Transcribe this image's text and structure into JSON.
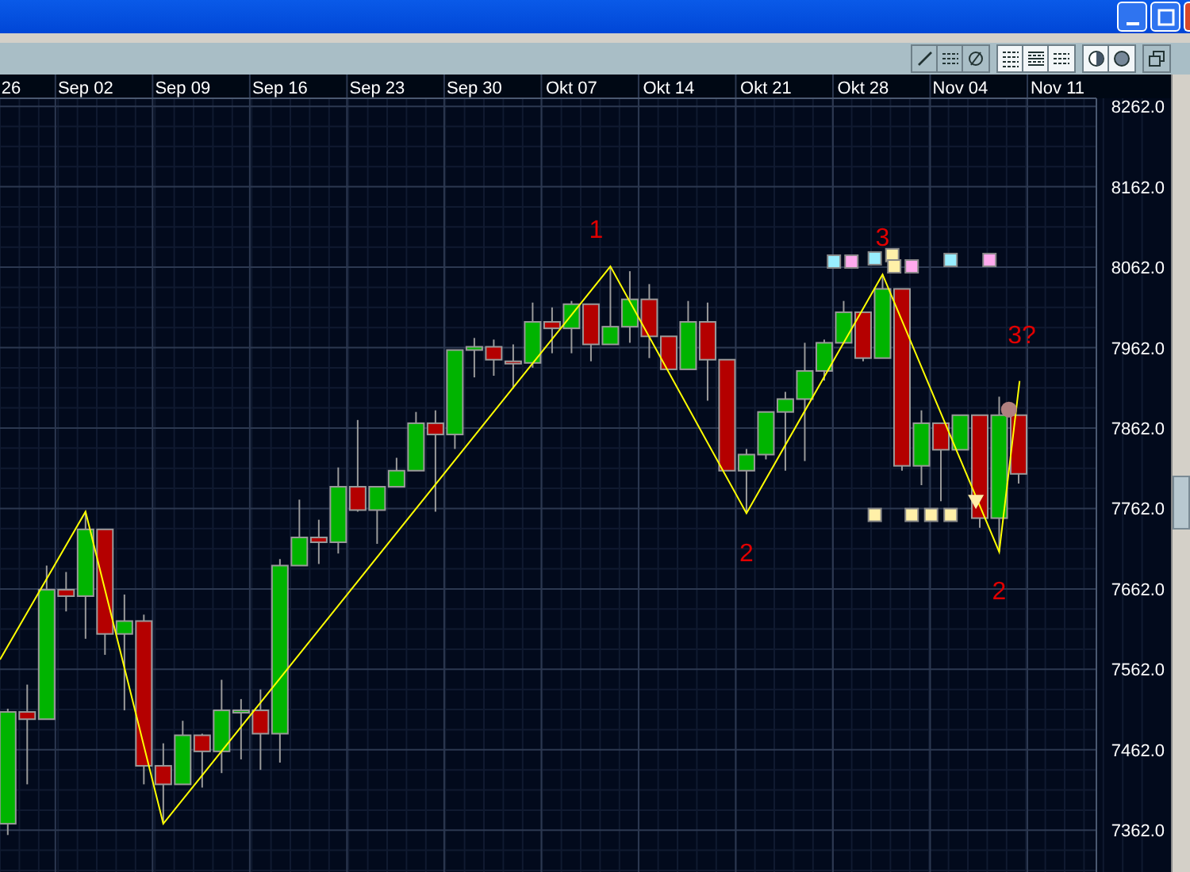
{
  "chart": {
    "chart_data": {
      "type": "candlestick",
      "ylim": [
        7310,
        8272
      ],
      "grid": true,
      "categories": [
        "26",
        null,
        null,
        null,
        "Sep 02",
        null,
        null,
        null,
        null,
        "Sep 09",
        null,
        null,
        null,
        null,
        "Sep 16",
        null,
        null,
        null,
        null,
        "Sep 23",
        null,
        null,
        null,
        null,
        "Sep 30",
        null,
        null,
        null,
        null,
        "Okt 07",
        null,
        null,
        null,
        null,
        "Okt 14",
        null,
        null,
        null,
        null,
        "Okt 21",
        null,
        null,
        null,
        null,
        "Okt 28",
        null,
        null,
        null,
        null,
        "Nov 04",
        null,
        null,
        null,
        null,
        "Nov 11",
        null
      ],
      "ohlc": [
        [
          7370,
          7513,
          7356,
          7509
        ],
        [
          7509,
          7543,
          7419,
          7500
        ],
        [
          7500,
          7691,
          7500,
          7661
        ],
        [
          7661,
          7683,
          7634,
          7653
        ],
        [
          7653,
          7758,
          7600,
          7736
        ],
        [
          7736,
          7736,
          7580,
          7606
        ],
        [
          7606,
          7655,
          7511,
          7622
        ],
        [
          7622,
          7630,
          7419,
          7442
        ],
        [
          7442,
          7470,
          7370,
          7419
        ],
        [
          7419,
          7498,
          7419,
          7480
        ],
        [
          7480,
          7482,
          7415,
          7460
        ],
        [
          7460,
          7549,
          7433,
          7511
        ],
        [
          7511,
          7525,
          7450,
          7511
        ],
        [
          7511,
          7537,
          7437,
          7482
        ],
        [
          7482,
          7699,
          7446,
          7691
        ],
        [
          7691,
          7773,
          7691,
          7726
        ],
        [
          7726,
          7748,
          7693,
          7720
        ],
        [
          7720,
          7813,
          7706,
          7789
        ],
        [
          7789,
          7872,
          7758,
          7760
        ],
        [
          7760,
          7789,
          7718,
          7789
        ],
        [
          7789,
          7825,
          7789,
          7809
        ],
        [
          7809,
          7882,
          7809,
          7868
        ],
        [
          7868,
          7884,
          7758,
          7854
        ],
        [
          7854,
          7959,
          7836,
          7959
        ],
        [
          7959,
          7974,
          7925,
          7963
        ],
        [
          7963,
          7972,
          7927,
          7947
        ],
        [
          7945,
          7966,
          7911,
          7943
        ],
        [
          7943,
          8018,
          7937,
          7994
        ],
        [
          7994,
          8012,
          7955,
          7986
        ],
        [
          7986,
          8020,
          7955,
          8016
        ],
        [
          8016,
          8016,
          7945,
          7966
        ],
        [
          7966,
          8063,
          7966,
          7988
        ],
        [
          7988,
          8057,
          7968,
          8022
        ],
        [
          8022,
          8041,
          7949,
          7976
        ],
        [
          7976,
          7976,
          7935,
          7935
        ],
        [
          7935,
          8020,
          7935,
          7994
        ],
        [
          7994,
          8018,
          7896,
          7947
        ],
        [
          7947,
          7947,
          7809,
          7809
        ],
        [
          7809,
          7836,
          7756,
          7829
        ],
        [
          7829,
          7882,
          7823,
          7882
        ],
        [
          7882,
          7907,
          7809,
          7898
        ],
        [
          7898,
          7968,
          7821,
          7933
        ],
        [
          7933,
          7972,
          7921,
          7968
        ],
        [
          7968,
          8020,
          7968,
          8006
        ],
        [
          8006,
          8006,
          7945,
          7949
        ],
        [
          7949,
          8053,
          7949,
          8035
        ],
        [
          8035,
          8035,
          7809,
          7815
        ],
        [
          7815,
          7884,
          7791,
          7868
        ],
        [
          7868,
          7868,
          7771,
          7835
        ],
        [
          7835,
          7878,
          7835,
          7878
        ],
        [
          7878,
          7878,
          7738,
          7750
        ],
        [
          7750,
          7901,
          7708,
          7878
        ],
        [
          7878,
          7878,
          7793,
          7805
        ],
        null,
        null,
        null
      ],
      "yticks": [
        {
          "value": 8262,
          "label": "8262.0"
        },
        {
          "value": 8162,
          "label": "8162.0"
        },
        {
          "value": 8062,
          "label": "8062.0"
        },
        {
          "value": 7962,
          "label": "7962.0"
        },
        {
          "value": 7862,
          "label": "7862.0"
        },
        {
          "value": 7762,
          "label": "7762.0"
        },
        {
          "value": 7662,
          "label": "7662.0"
        },
        {
          "value": 7562,
          "label": "7562.0"
        },
        {
          "value": 7462,
          "label": "7462.0"
        },
        {
          "value": 7362,
          "label": "7362.0"
        }
      ],
      "annotations": [
        "1",
        "2",
        "3",
        "2",
        "3?"
      ]
    },
    "signal_markers": [
      {
        "kind": "square",
        "color": "#99eeff"
      },
      {
        "kind": "square",
        "color": "#ffaaee"
      },
      {
        "kind": "square",
        "color": "#99eeff"
      },
      {
        "kind": "square",
        "color": "#fff0a8"
      },
      {
        "kind": "square",
        "color": "#fff0a8"
      },
      {
        "kind": "square",
        "color": "#ffaaee"
      },
      {
        "kind": "square",
        "color": "#99eeff"
      },
      {
        "kind": "square",
        "color": "#ffaaee"
      },
      {
        "kind": "square",
        "color": "#fff0a8"
      },
      {
        "kind": "square",
        "color": "#fff0a8"
      },
      {
        "kind": "square",
        "color": "#fff0a8"
      },
      {
        "kind": "square",
        "color": "#fff0a8"
      },
      {
        "kind": "triangle",
        "color": "#fff0a8"
      },
      {
        "kind": "circle",
        "color": "#b08080"
      }
    ]
  }
}
